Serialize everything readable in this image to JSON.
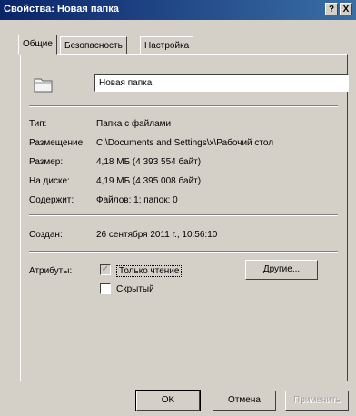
{
  "window": {
    "title": "Свойства: Новая папка",
    "help_glyph": "?",
    "close_glyph": "X"
  },
  "tabs": [
    {
      "label": "Общие"
    },
    {
      "label": "Безопасность"
    },
    {
      "label": "Настройка"
    }
  ],
  "general": {
    "folder_name": "Новая папка",
    "type_label": "Тип:",
    "type_value": "Папка с файлами",
    "location_label": "Размещение:",
    "location_value": "C:\\Documents and Settings\\x\\Рабочий стол",
    "size_label": "Размер:",
    "size_value": "4,18 МБ (4 393 554 байт)",
    "disk_size_label": "На диске:",
    "disk_size_value": "4,19 МБ (4 395 008 байт)",
    "contains_label": "Содержит:",
    "contains_value": "Файлов: 1; папок: 0",
    "created_label": "Создан:",
    "created_value": "26 сентября 2011 г., 10:56:10",
    "attributes_label": "Атрибуты:",
    "readonly_label": "Только чтение",
    "hidden_label": "Скрытый",
    "readonly_checked": true,
    "hidden_checked": false,
    "other_button": "Другие..."
  },
  "footer": {
    "ok": "OK",
    "cancel": "Отмена",
    "apply": "Применить"
  },
  "icons": {
    "folder": "folder-icon"
  }
}
